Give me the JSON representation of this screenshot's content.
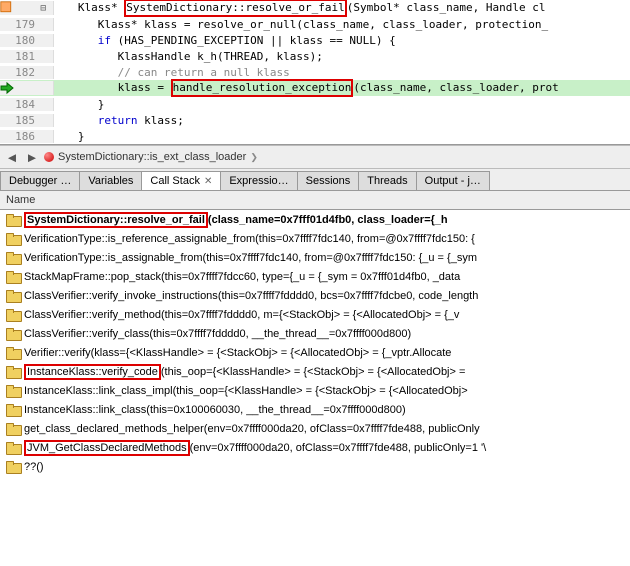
{
  "editor": {
    "lines": [
      {
        "n": "",
        "indent": 1,
        "parts": [
          {
            "t": "Klass* ",
            "c": ""
          },
          {
            "t": "SystemDictionary::resolve_or_fail",
            "c": "",
            "box": true
          },
          {
            "t": "(",
            "c": ""
          },
          {
            "t": "Symbol",
            "c": "type"
          },
          {
            "t": "* class_name, ",
            "c": ""
          },
          {
            "t": "Handle",
            "c": "type"
          },
          {
            "t": " cl",
            "c": ""
          }
        ],
        "fold": "⊟",
        "bp": true
      },
      {
        "n": "179",
        "indent": 2,
        "parts": [
          {
            "t": "Klass* klass = resolve_or_null(class_name, class_loader, protection_",
            "c": ""
          }
        ]
      },
      {
        "n": "180",
        "indent": 2,
        "parts": [
          {
            "t": "if",
            "c": "kw"
          },
          {
            "t": " (HAS_PENDING_EXCEPTION || klass == NULL) {",
            "c": ""
          }
        ]
      },
      {
        "n": "181",
        "indent": 3,
        "parts": [
          {
            "t": "KlassHandle",
            "c": "type"
          },
          {
            "t": " k_h(THREAD, klass);",
            "c": ""
          }
        ]
      },
      {
        "n": "182",
        "indent": 3,
        "parts": [
          {
            "t": "// can return a null klass",
            "c": "comment"
          }
        ]
      },
      {
        "n": "",
        "indent": 3,
        "hl": true,
        "arrow": true,
        "parts": [
          {
            "t": "klass = ",
            "c": ""
          },
          {
            "t": "handle_resolution_exception",
            "c": "",
            "box": true
          },
          {
            "t": "(class_name, class_loader, prot",
            "c": ""
          }
        ]
      },
      {
        "n": "184",
        "indent": 2,
        "parts": [
          {
            "t": "}",
            "c": ""
          }
        ]
      },
      {
        "n": "185",
        "indent": 2,
        "parts": [
          {
            "t": "return",
            "c": "kw"
          },
          {
            "t": " klass;",
            "c": ""
          }
        ]
      },
      {
        "n": "186",
        "indent": 1,
        "parts": [
          {
            "t": "}",
            "c": ""
          }
        ]
      }
    ]
  },
  "nav": {
    "label": "SystemDictionary::is_ext_class_loader"
  },
  "tabs": [
    {
      "label": "Debugger …",
      "active": false
    },
    {
      "label": "Variables",
      "active": false
    },
    {
      "label": "Call Stack",
      "active": true,
      "closable": true
    },
    {
      "label": "Expressio…",
      "active": false
    },
    {
      "label": "Sessions",
      "active": false
    },
    {
      "label": "Threads",
      "active": false
    },
    {
      "label": "Output - j…",
      "active": false
    }
  ],
  "col_header": "Name",
  "frames": [
    {
      "fn": "SystemDictionary::resolve_or_fail",
      "args": " (class_name=0x7fff01d4fb0, class_loader={_h",
      "current": true,
      "box": true
    },
    {
      "fn": "VerificationType::is_reference_assignable_from",
      "args": " (this=0x7ffff7fdc140, from=@0x7ffff7fdc150: {"
    },
    {
      "fn": "VerificationType::is_assignable_from",
      "args": " (this=0x7ffff7fdc140, from=@0x7ffff7fdc150: {_u = {_sym"
    },
    {
      "fn": "StackMapFrame::pop_stack",
      "args": " (this=0x7ffff7fdcc60, type={_u = {_sym = 0x7fff01d4fb0, _data"
    },
    {
      "fn": "ClassVerifier::verify_invoke_instructions",
      "args": " (this=0x7ffff7fdddd0, bcs=0x7ffff7fdcbe0, code_length"
    },
    {
      "fn": "ClassVerifier::verify_method",
      "args": " (this=0x7ffff7fdddd0, m={<StackObj> = {<AllocatedObj> = {_v"
    },
    {
      "fn": "ClassVerifier::verify_class",
      "args": " (this=0x7ffff7fdddd0, __the_thread__=0x7ffff000d800)"
    },
    {
      "fn": "Verifier::verify",
      "args": " (klass={<KlassHandle> = {<StackObj> = {<AllocatedObj> = {_vptr.Allocate"
    },
    {
      "fn": "InstanceKlass::verify_code",
      "args": " (this_oop={<KlassHandle> = {<StackObj> = {<AllocatedObj> =",
      "box": true
    },
    {
      "fn": "InstanceKlass::link_class_impl",
      "args": " (this_oop={<KlassHandle> = {<StackObj> = {<AllocatedObj>"
    },
    {
      "fn": "InstanceKlass::link_class",
      "args": " (this=0x100060030, __the_thread__=0x7ffff000d800)"
    },
    {
      "fn": "get_class_declared_methods_helper",
      "args": " (env=0x7ffff000da20, ofClass=0x7ffff7fde488, publicOnly"
    },
    {
      "fn": "JVM_GetClassDeclaredMethods",
      "args": " (env=0x7ffff000da20, ofClass=0x7ffff7fde488, publicOnly=1 '\\",
      "box": true
    },
    {
      "fn": "??",
      "args": " ()"
    }
  ]
}
